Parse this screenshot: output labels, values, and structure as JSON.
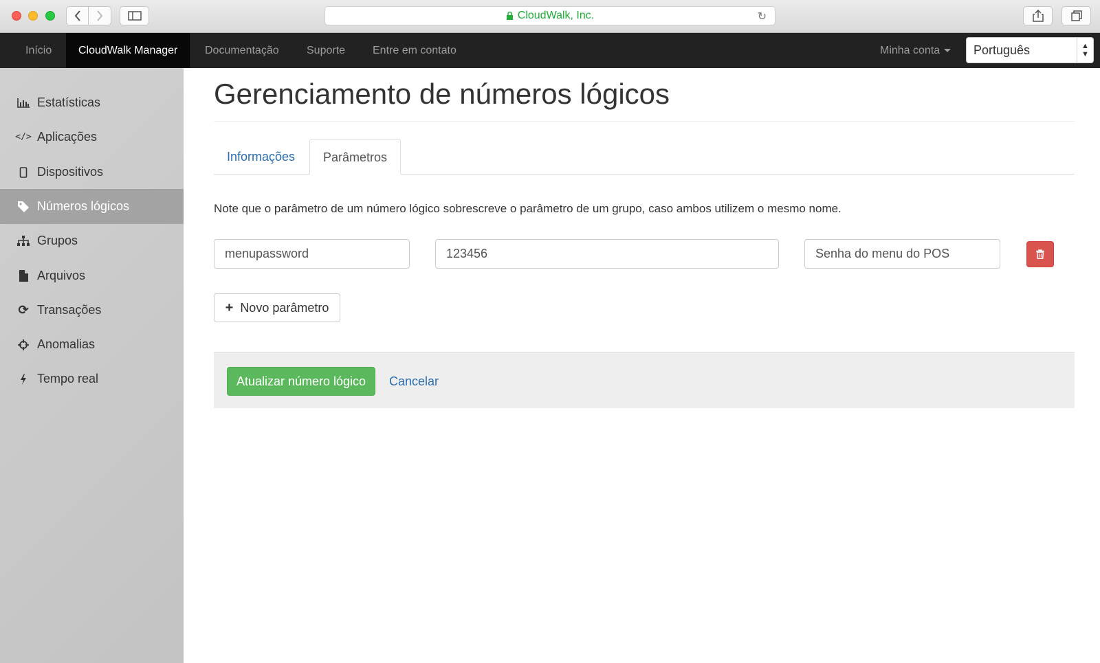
{
  "browser": {
    "address": "CloudWalk, Inc."
  },
  "navbar": {
    "items": [
      {
        "label": "Início"
      },
      {
        "label": "CloudWalk Manager"
      },
      {
        "label": "Documentação"
      },
      {
        "label": "Suporte"
      },
      {
        "label": "Entre em contato"
      }
    ],
    "account": "Minha conta",
    "language": "Português"
  },
  "sidebar": {
    "items": [
      {
        "label": "Estatísticas",
        "icon": "bar-chart-icon"
      },
      {
        "label": "Aplicações",
        "icon": "code-icon"
      },
      {
        "label": "Dispositivos",
        "icon": "device-icon"
      },
      {
        "label": "Números lógicos",
        "icon": "tag-icon"
      },
      {
        "label": "Grupos",
        "icon": "sitemap-icon"
      },
      {
        "label": "Arquivos",
        "icon": "file-icon"
      },
      {
        "label": "Transações",
        "icon": "refresh-icon"
      },
      {
        "label": "Anomalias",
        "icon": "crosshair-icon"
      },
      {
        "label": "Tempo real",
        "icon": "flash-icon"
      }
    ]
  },
  "main": {
    "title": "Gerenciamento de números lógicos",
    "tabs": [
      {
        "label": "Informações"
      },
      {
        "label": "Parâmetros"
      }
    ],
    "note": "Note que o parâmetro de um número lógico sobrescreve o parâmetro de um grupo, caso ambos utilizem o mesmo nome.",
    "parameter": {
      "name": "menupassword",
      "value": "123456",
      "description": "Senha do menu do POS"
    },
    "new_parameter": "Novo parâmetro",
    "update_button": "Atualizar número lógico",
    "cancel_link": "Cancelar"
  },
  "colors": {
    "navbar_bg": "#222222",
    "primary_link": "#2a6db0",
    "success": "#5cb85c",
    "danger": "#d9534f",
    "address_text": "#1fae38"
  }
}
